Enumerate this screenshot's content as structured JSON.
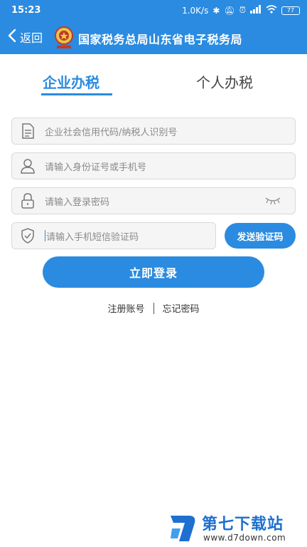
{
  "status_bar": {
    "time": "15:23",
    "net_speed": "1.0K/s",
    "battery": "77"
  },
  "header": {
    "back_label": "返回",
    "title": "国家税务总局山东省电子税务局",
    "emblem_icon": "tax-emblem-icon"
  },
  "tabs": [
    {
      "label": "企业办税",
      "active": true
    },
    {
      "label": "个人办税",
      "active": false
    }
  ],
  "form": {
    "credit_code_placeholder": "企业社会信用代码/纳税人识别号",
    "id_placeholder": "请输入身份证号或手机号",
    "password_placeholder": "请输入登录密码",
    "sms_placeholder": "请输入手机短信验证码",
    "send_code_label": "发送验证码",
    "login_label": "立即登录"
  },
  "links": {
    "register": "注册账号",
    "forgot": "忘记密码"
  },
  "watermark": {
    "title": "第七下载站",
    "url": "www.d7down.com"
  },
  "colors": {
    "primary": "#2a8be0",
    "field_bg": "#f5f5f5",
    "placeholder": "#8a8a8a"
  }
}
